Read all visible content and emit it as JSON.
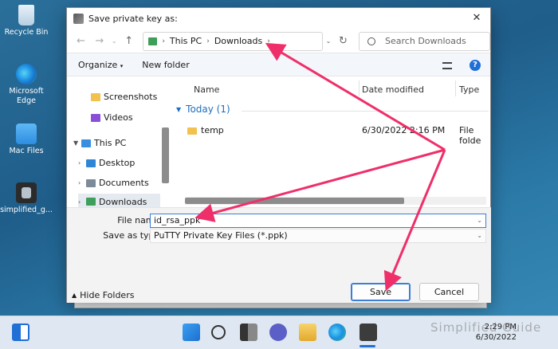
{
  "desktop": {
    "icons": [
      {
        "label": "Recycle Bin"
      },
      {
        "label": "Microsoft Edge"
      },
      {
        "label": "Mac Files"
      },
      {
        "label": "simplified_g..."
      }
    ]
  },
  "dialog": {
    "title": "Save private key as:",
    "close_glyph": "✕",
    "address": {
      "crumbs": [
        "This PC",
        "Downloads"
      ],
      "sep": "›"
    },
    "search": {
      "placeholder": "Search Downloads"
    },
    "commands": {
      "organize": "Organize",
      "organize_arrow": "▾",
      "new_folder": "New folder"
    },
    "help": "?",
    "nav": {
      "items": [
        {
          "label": "Screenshots",
          "icon": "folder-icon"
        },
        {
          "label": "Videos",
          "icon": "video-icon"
        },
        {
          "label": "This PC",
          "icon": "pc-icon",
          "expanded": true
        },
        {
          "label": "Desktop",
          "icon": "desktop-icon"
        },
        {
          "label": "Documents",
          "icon": "documents-icon"
        },
        {
          "label": "Downloads",
          "icon": "downloads-icon",
          "selected": true
        }
      ]
    },
    "columns": {
      "name": "Name",
      "date": "Date modified",
      "type": "Type"
    },
    "group": {
      "label": "Today (1)"
    },
    "files": [
      {
        "name": "temp",
        "date": "6/30/2022 2:16 PM",
        "type": "File folde"
      }
    ],
    "file_name": {
      "label": "File name:",
      "value": "id_rsa_ppk"
    },
    "save_type": {
      "label": "Save as type:",
      "value": "PuTTY Private Key Files (*.ppk)"
    },
    "hide_folders": "Hide Folders",
    "buttons": {
      "save": "Save",
      "cancel": "Cancel"
    }
  },
  "taskbar": {
    "time": "2:29 PM",
    "date": "6/30/2022"
  },
  "watermark": "Simplified Guide",
  "colors": {
    "accent": "#1f6fd6",
    "arrow": "#ef2f6a"
  }
}
